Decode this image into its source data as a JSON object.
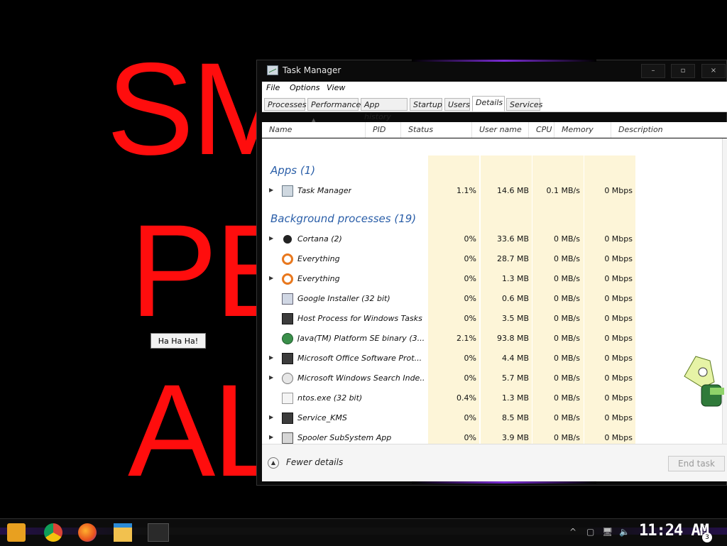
{
  "desktop": {
    "big_text": [
      "SM",
      "PE",
      "AL"
    ],
    "haha_button": "Ha Ha Ha!"
  },
  "window": {
    "title": "Task Manager",
    "controls": {
      "minimize": "–",
      "maximize": "▫",
      "close": "×"
    },
    "menu": [
      "File",
      "Options",
      "View"
    ],
    "tabs": [
      "Processes",
      "Performance",
      "App history",
      "Startup",
      "Users",
      "Details",
      "Services"
    ],
    "active_tab": "Details",
    "columns": [
      "Name",
      "PID",
      "Status",
      "User name",
      "CPU",
      "Memory (pr...",
      "Description"
    ],
    "sections": {
      "apps": "Apps (1)",
      "background": "Background processes (19)"
    },
    "apps": [
      {
        "name": "Task Manager",
        "expandable": true,
        "cpu": "1.1%",
        "memory": "14.6 MB",
        "disk": "0.1 MB/s",
        "network": "0 Mbps",
        "icon": "task-manager-icon"
      }
    ],
    "processes": [
      {
        "name": "Cortana (2)",
        "expandable": true,
        "cpu": "0%",
        "memory": "33.6 MB",
        "disk": "0 MB/s",
        "network": "0 Mbps",
        "icon": "cortana-icon"
      },
      {
        "name": "Everything",
        "expandable": false,
        "cpu": "0%",
        "memory": "28.7 MB",
        "disk": "0 MB/s",
        "network": "0 Mbps",
        "icon": "magnifier-icon"
      },
      {
        "name": "Everything",
        "expandable": true,
        "cpu": "0%",
        "memory": "1.3 MB",
        "disk": "0 MB/s",
        "network": "0 Mbps",
        "icon": "magnifier-icon"
      },
      {
        "name": "Google Installer (32 bit)",
        "expandable": false,
        "cpu": "0%",
        "memory": "0.6 MB",
        "disk": "0 MB/s",
        "network": "0 Mbps",
        "icon": "installer-icon"
      },
      {
        "name": "Host Process for Windows Tasks",
        "expandable": false,
        "cpu": "0%",
        "memory": "3.5 MB",
        "disk": "0 MB/s",
        "network": "0 Mbps",
        "icon": "app-window-icon"
      },
      {
        "name": "Java(TM) Platform SE binary (3...",
        "expandable": false,
        "cpu": "2.1%",
        "memory": "93.8 MB",
        "disk": "0 MB/s",
        "network": "0 Mbps",
        "icon": "java-icon"
      },
      {
        "name": "Microsoft Office Software Prot...",
        "expandable": true,
        "cpu": "0%",
        "memory": "4.4 MB",
        "disk": "0 MB/s",
        "network": "0 Mbps",
        "icon": "app-window-icon"
      },
      {
        "name": "Microsoft Windows Search Inde...",
        "expandable": true,
        "cpu": "0%",
        "memory": "5.7 MB",
        "disk": "0 MB/s",
        "network": "0 Mbps",
        "icon": "search-indexer-icon"
      },
      {
        "name": "ntos.exe (32 bit)",
        "expandable": false,
        "cpu": "0.4%",
        "memory": "1.3 MB",
        "disk": "0 MB/s",
        "network": "0 Mbps",
        "icon": "executable-icon"
      },
      {
        "name": "Service_KMS",
        "expandable": true,
        "cpu": "0%",
        "memory": "8.5 MB",
        "disk": "0 MB/s",
        "network": "0 Mbps",
        "icon": "app-window-icon"
      },
      {
        "name": "Spooler SubSystem App",
        "expandable": true,
        "cpu": "0%",
        "memory": "3.9 MB",
        "disk": "0 MB/s",
        "network": "0 Mbps",
        "icon": "printer-icon"
      }
    ],
    "footer": {
      "fewer_details": "Fewer details",
      "end_task": "End task"
    }
  },
  "taskbar": {
    "clock": "11:24 AM",
    "notification_count": "3",
    "pinned": [
      "start-icon",
      "chrome-icon",
      "firefox-icon",
      "file-explorer-icon",
      "task-manager-icon"
    ]
  },
  "colors": {
    "desktop_text": "#ff0d0d",
    "section_header": "#2a5ea8",
    "highlight_column": "#fdf5d8"
  }
}
